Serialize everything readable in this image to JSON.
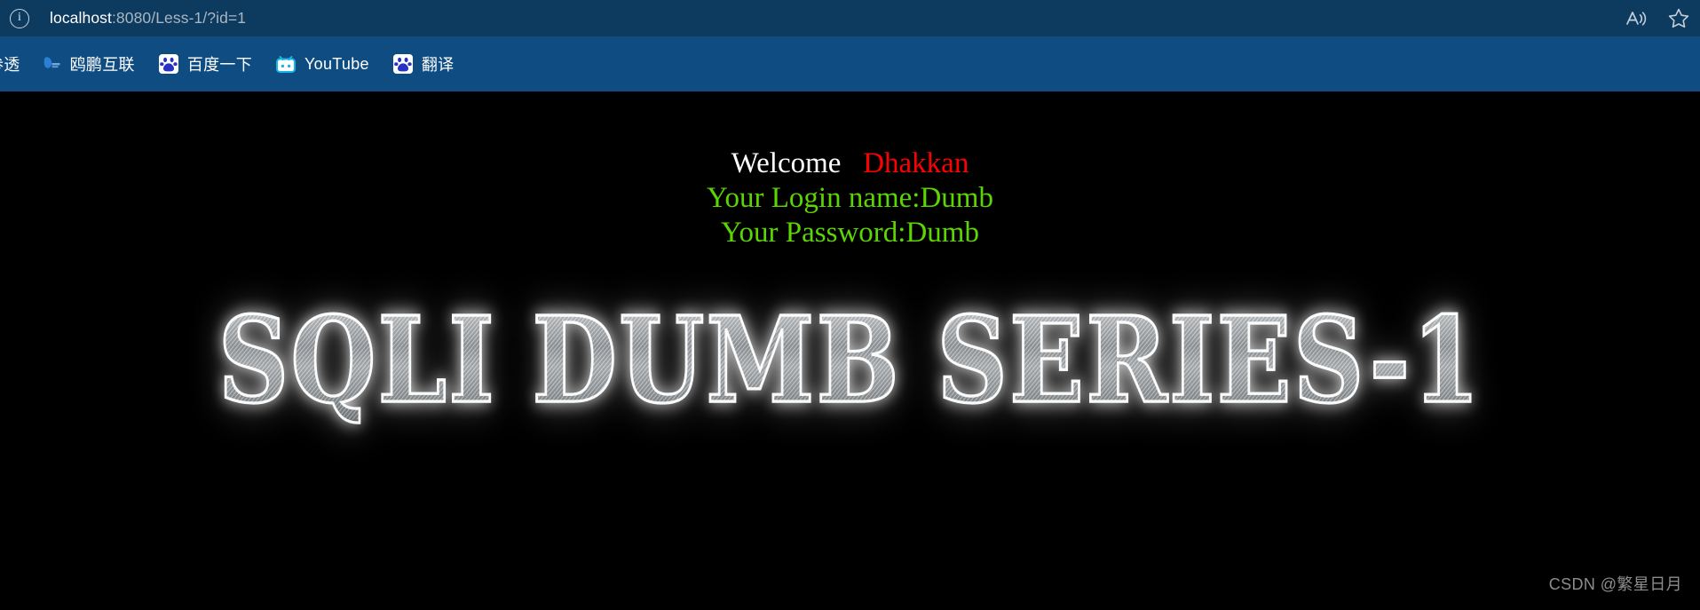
{
  "browser": {
    "address_bar": {
      "site_info_icon": "info-circle-icon",
      "url_host": "localhost",
      "url_rest": ":8080/Less-1/?id=1",
      "url_full": "localhost:8080/Less-1/?id=1"
    },
    "toolbar_actions": [
      {
        "name": "read-aloud-icon",
        "label": "Read aloud"
      },
      {
        "name": "favorites-star-icon",
        "label": "Favorites"
      }
    ],
    "bookmarks": [
      {
        "label": "参透",
        "icon": "globe-icon"
      },
      {
        "label": "鸥鹏互联",
        "icon": "opc-logo-icon"
      },
      {
        "label": "百度一下",
        "icon": "baidu-paw-icon"
      },
      {
        "label": "YouTube",
        "icon": "youtube-icon"
      },
      {
        "label": "翻译",
        "icon": "baidu-translate-icon"
      }
    ],
    "colors": {
      "address_bar_bg": "#0d3a5f",
      "bookmarks_bar_bg": "#0f4c81",
      "page_bg": "#000000"
    }
  },
  "page": {
    "greeting": {
      "welcome_label": "Welcome",
      "spacer": "   ",
      "user_name": "Dhakkan",
      "login_line": "Your Login name:Dumb",
      "password_line": "Your Password:Dumb",
      "welcome_color": "#ffffff",
      "user_color": "#fe0000",
      "credential_color": "#5bd600"
    },
    "banner": {
      "title": "SQLI DUMB SERIES-1"
    },
    "watermark": "CSDN @繁星日月"
  }
}
